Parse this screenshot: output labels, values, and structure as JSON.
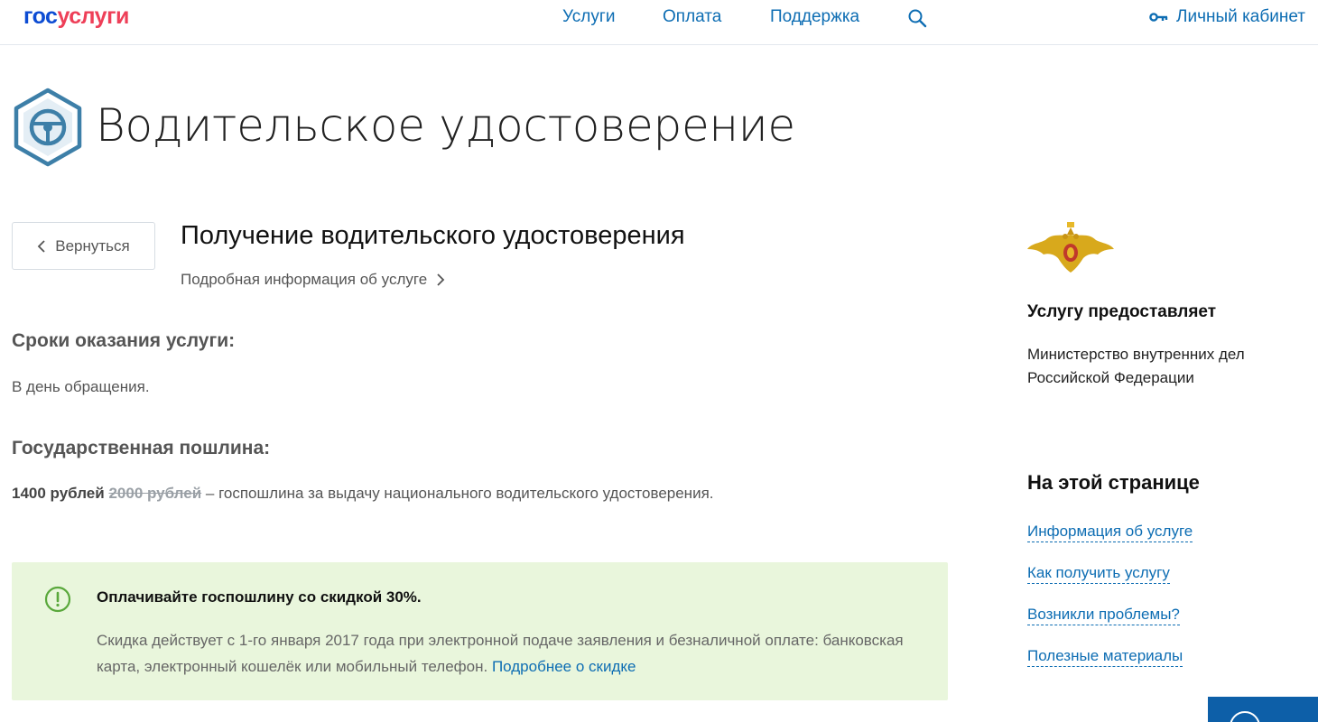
{
  "header": {
    "logo_part1": "гос",
    "logo_part2": "услуги",
    "nav": [
      "Услуги",
      "Оплата",
      "Поддержка"
    ],
    "cabinet_label": "Личный кабинет"
  },
  "page": {
    "title": "Водительское удостоверение",
    "back_label": "Вернуться",
    "service_title": "Получение водительского удостоверения",
    "more_info": "Подробная информация об услуге"
  },
  "terms": {
    "heading": "Сроки оказания услуги:",
    "text": "В день обращения."
  },
  "fee": {
    "heading": "Государственная пошлина:",
    "price": "1400 рублей",
    "old_price": "2000 рублей",
    "description": " – госпошлина за выдачу национального водительского удостоверения."
  },
  "banner": {
    "title": "Оплачивайте госпошлину со скидкой 30%.",
    "text": "Скидка действует с 1-го января 2017 года при электронной подаче заявления и безналичной оплате: банковская карта, электронный кошелёк или мобильный телефон. ",
    "link": "Подробнее о скидке"
  },
  "sidebar": {
    "provider_heading": "Услугу предоставляет",
    "provider_line1": "Министерство внутренних дел",
    "provider_line2": "Российской Федерации",
    "onpage_heading": "На этой странице",
    "links": [
      "Информация об услуге",
      "Как получить услугу",
      "Возникли проблемы?",
      "Полезные материалы"
    ]
  },
  "colors": {
    "link": "#0d6db3",
    "logo_blue": "#0d4cd3",
    "logo_red": "#ee3f58",
    "banner_bg": "#e9f6dc",
    "icon_teal": "#3d7fa8"
  },
  "icons": {
    "search": "search-icon",
    "key": "key-icon",
    "steering": "steering-wheel-icon",
    "back": "chevron-left-icon",
    "more": "chevron-right-icon",
    "info": "exclamation-circle-icon",
    "emblem": "double-headed-eagle-emblem"
  }
}
